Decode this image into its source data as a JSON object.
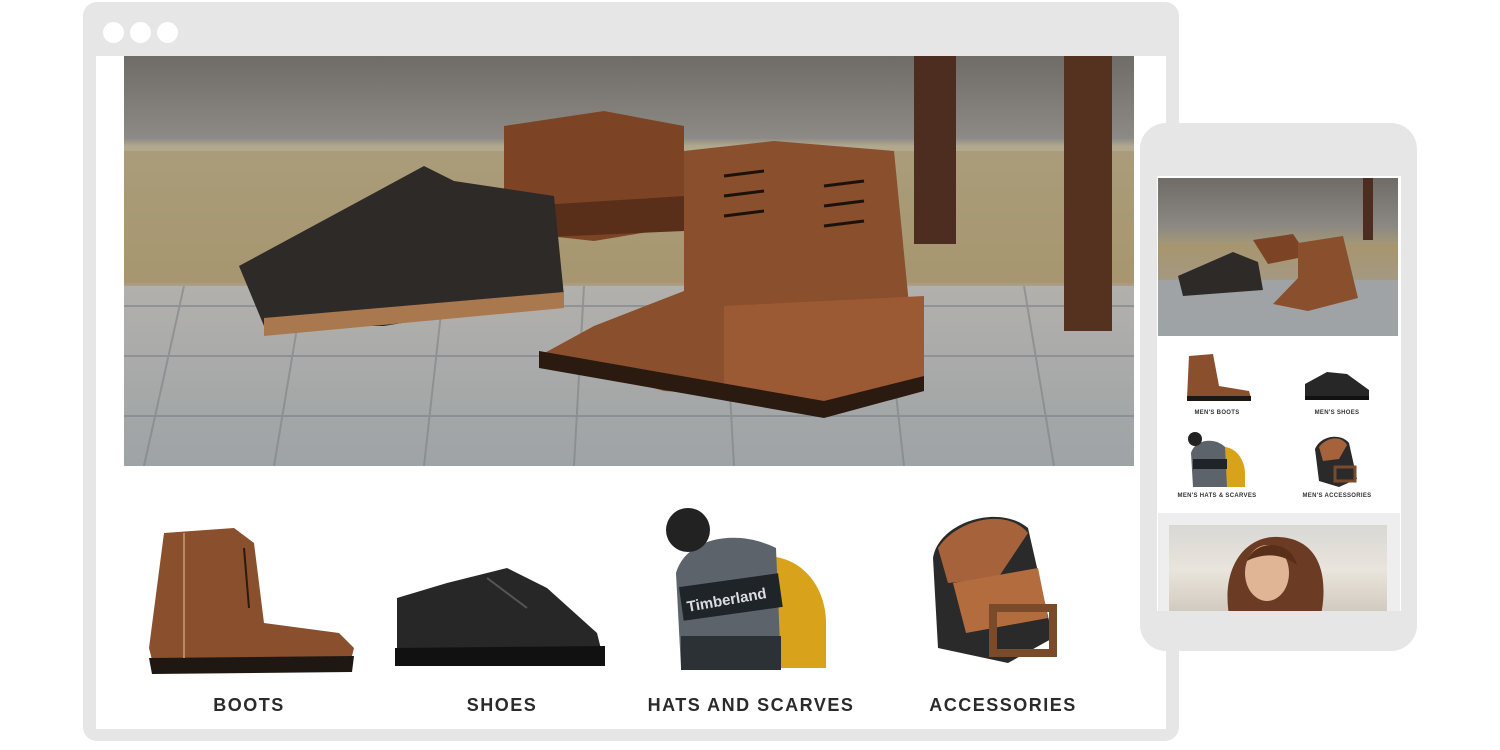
{
  "desktop": {
    "hero_alt": "Leather boots and shoes on a wooden floor",
    "categories": [
      {
        "label": "BOOTS",
        "icon": "boot-icon"
      },
      {
        "label": "SHOES",
        "icon": "shoe-icon"
      },
      {
        "label": "HATS AND SCARVES",
        "icon": "beanie-icon"
      },
      {
        "label": "ACCESSORIES",
        "icon": "belt-icon"
      }
    ]
  },
  "mobile": {
    "categories": [
      {
        "label": "MEN'S BOOTS"
      },
      {
        "label": "MEN'S SHOES"
      },
      {
        "label": "MEN'S HATS & SCARVES"
      },
      {
        "label": "MEN'S ACCESSORIES"
      }
    ],
    "beanie_text": "Timberland"
  },
  "colors": {
    "frame": "#e6e6e6",
    "label": "#2b2b2b",
    "leather": "#8a4f2c",
    "black_leather": "#2a2a2a",
    "yellow": "#d8a21b"
  }
}
